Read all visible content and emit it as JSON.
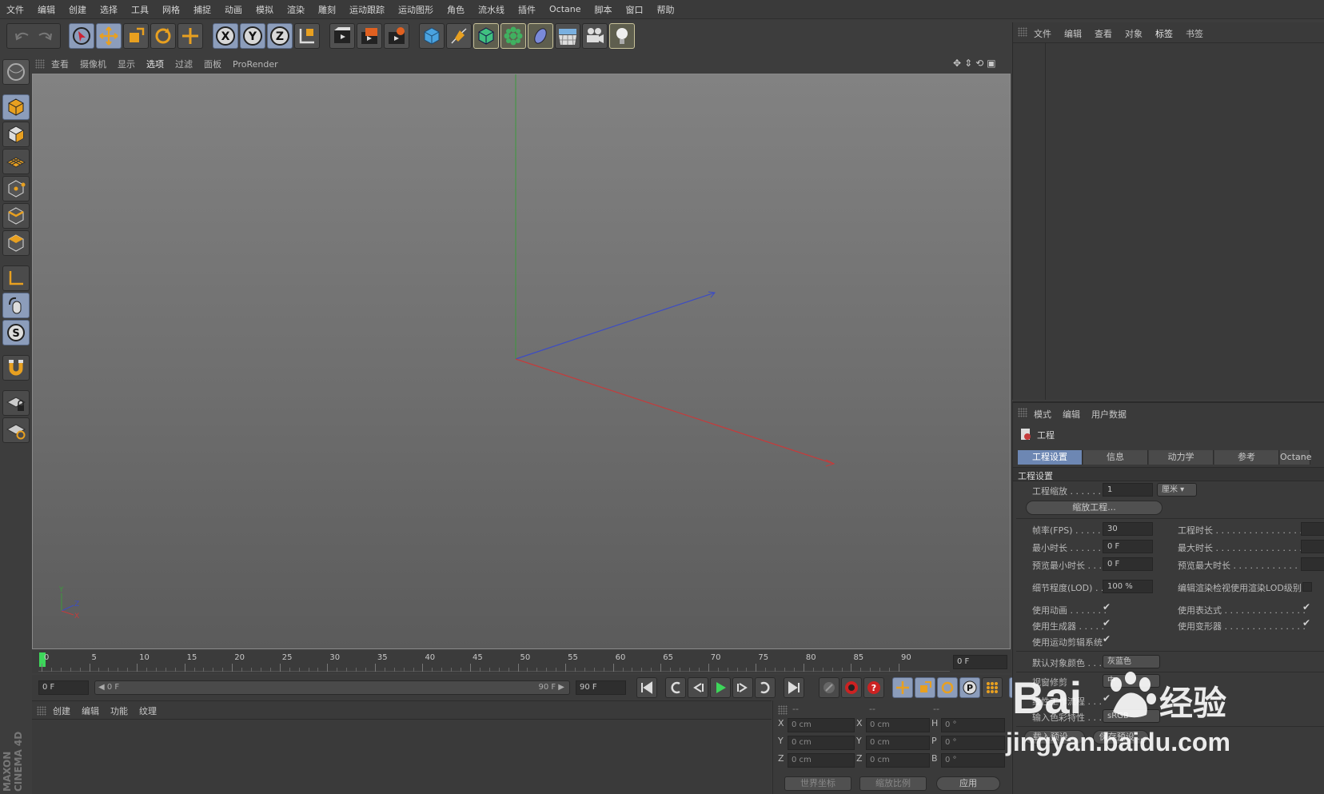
{
  "menubar": {
    "items": [
      "文件",
      "编辑",
      "创建",
      "选择",
      "工具",
      "网格",
      "捕捉",
      "动画",
      "模拟",
      "渲染",
      "雕刻",
      "运动跟踪",
      "运动图形",
      "角色",
      "流水线",
      "插件",
      "Octane",
      "脚本",
      "窗口",
      "帮助"
    ]
  },
  "toolbar": {
    "axis_x": "X",
    "axis_y": "Y",
    "axis_z": "Z",
    "icons": [
      "undo-icon",
      "redo-icon",
      "select-cursor-icon",
      "move-icon",
      "scale-icon",
      "rotate-icon",
      "live-select-icon",
      "x-axis-lock-icon",
      "y-axis-lock-icon",
      "z-axis-lock-icon",
      "coordinate-system-icon",
      "render-view-icon",
      "render-picture-viewer-icon",
      "render-settings-icon",
      "cube-icon",
      "pen-icon",
      "subdivision-icon",
      "cloner-icon",
      "deformer-icon",
      "floor-icon",
      "camera-icon",
      "light-icon"
    ]
  },
  "viewport": {
    "menu": [
      "查看",
      "摄像机",
      "显示",
      "选项",
      "过滤",
      "面板",
      "ProRender"
    ],
    "active_menu": "选项",
    "mini_axis": {
      "y": "Y",
      "z": "Z",
      "x": "X"
    }
  },
  "timeline": {
    "ticks": [
      "0",
      "5",
      "10",
      "15",
      "20",
      "25",
      "30",
      "35",
      "40",
      "45",
      "50",
      "55",
      "60",
      "65",
      "70",
      "75",
      "80",
      "85",
      "90"
    ],
    "current_frame": "0 F"
  },
  "transport": {
    "start_field": "0 F",
    "range_start": "◀ 0 F",
    "range_end": "90 F ▶",
    "end_field": "90 F"
  },
  "material_panel": {
    "menu": [
      "创建",
      "编辑",
      "功能",
      "纹理"
    ]
  },
  "coord_panel": {
    "headers": [
      "--",
      "--",
      "--"
    ],
    "rows": [
      {
        "axis": "X",
        "pos": "0 cm",
        "size_axis": "X",
        "size": "0 cm",
        "rot_axis": "H",
        "rot": "0 °"
      },
      {
        "axis": "Y",
        "pos": "0 cm",
        "size_axis": "Y",
        "size": "0 cm",
        "rot_axis": "P",
        "rot": "0 °"
      },
      {
        "axis": "Z",
        "pos": "0 cm",
        "size_axis": "Z",
        "size": "0 cm",
        "rot_axis": "B",
        "rot": "0 °"
      }
    ],
    "world_coords": "世界坐标",
    "scale_mode": "缩放比例",
    "apply": "应用"
  },
  "object_manager": {
    "menu": [
      "文件",
      "编辑",
      "查看",
      "对象",
      "标签",
      "书签"
    ],
    "active": "标签"
  },
  "attributes": {
    "menu": [
      "模式",
      "编辑",
      "用户数据"
    ],
    "object_title": "工程",
    "tabs": [
      "工程设置",
      "信息",
      "动力学",
      "参考",
      "Octane"
    ],
    "active_tab": "工程设置",
    "section": "工程设置",
    "project_scale_label": "工程缩放 . . . . . . .",
    "project_scale_value": "1",
    "project_scale_unit": "厘米",
    "scale_project_btn": "缩放工程...",
    "fps_label": "帧率(FPS) . . . . . .",
    "fps_value": "30",
    "project_length_label": "工程时长 . . . . . . . . . . . . . . . .",
    "min_time_label": "最小时长 . . . . . . .",
    "min_time_value": "0 F",
    "max_time_label": "最大时长 . . . . . . . . . . . . . . . .",
    "preview_min_label": "预览最小时长 . . .",
    "preview_min_value": "0 F",
    "preview_max_label": "预览最大时长 . . . . . . . . . . . . .",
    "lod_label": "细节程度(LOD) . .",
    "lod_value": "100 %",
    "lod_render_label": "编辑渲染检视使用渲染LOD级别",
    "use_animation_label": "使用动画 . . . . . . .",
    "use_expression_label": "使用表达式 . . . . . . . . . . . . . . .",
    "use_generator_label": "使用生成器 . . . . .",
    "use_deformer_label": "使用变形器 . . . . . . . . . . . . . . .",
    "use_motion_clip_label": "使用运动剪辑系统",
    "default_color_label": "默认对象颜色 . . .",
    "default_color_value": "灰蓝色",
    "view_clip_label": "视窗修剪",
    "view_clip_value": "中",
    "linear_workflow_label": "线性工作流程 . . .",
    "input_color_label": "输入色彩特性 . . .",
    "input_color_value": "sRGB",
    "load_preset": "载入预设...",
    "save_preset": "保存预设..."
  },
  "watermark": {
    "brand": "Bai",
    "brand_cn": "经验",
    "url": "jingyan.baidu.com"
  },
  "sidebar_brand": "MAXON CINEMA 4D",
  "colors": {
    "accent": "#6d87b3",
    "active_tool": "#8c9dbb",
    "x_axis": "#c43c3c",
    "y_axis": "#3c9a3c",
    "z_axis": "#3c4cc4"
  }
}
